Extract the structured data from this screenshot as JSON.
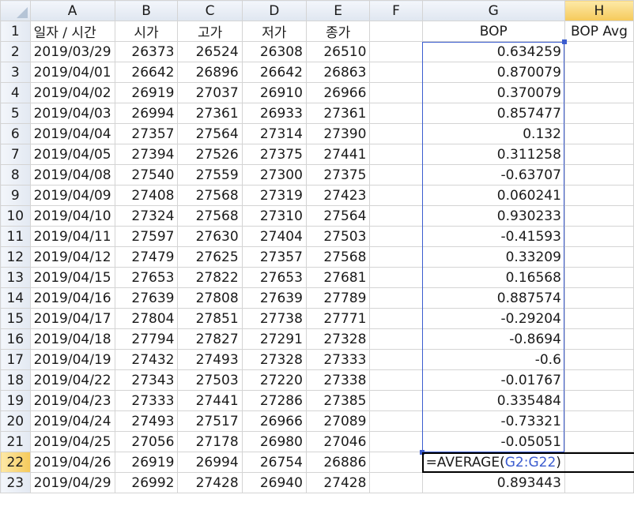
{
  "columns": [
    "A",
    "B",
    "C",
    "D",
    "E",
    "F",
    "G",
    "H"
  ],
  "header_row": {
    "number": "1",
    "cells": [
      "일자 / 시간",
      "시가",
      "고가",
      "저가",
      "종가",
      "",
      "BOP",
      "BOP Avg"
    ]
  },
  "rows": [
    {
      "n": "2",
      "date": "2019/03/29",
      "open": "26373",
      "high": "26524",
      "low": "26308",
      "close": "26510",
      "bop": "0.634259"
    },
    {
      "n": "3",
      "date": "2019/04/01",
      "open": "26642",
      "high": "26896",
      "low": "26642",
      "close": "26863",
      "bop": "0.870079"
    },
    {
      "n": "4",
      "date": "2019/04/02",
      "open": "26919",
      "high": "27037",
      "low": "26910",
      "close": "26966",
      "bop": "0.370079"
    },
    {
      "n": "5",
      "date": "2019/04/03",
      "open": "26994",
      "high": "27361",
      "low": "26933",
      "close": "27361",
      "bop": "0.857477"
    },
    {
      "n": "6",
      "date": "2019/04/04",
      "open": "27357",
      "high": "27564",
      "low": "27314",
      "close": "27390",
      "bop": "0.132"
    },
    {
      "n": "7",
      "date": "2019/04/05",
      "open": "27394",
      "high": "27526",
      "low": "27375",
      "close": "27441",
      "bop": "0.311258"
    },
    {
      "n": "8",
      "date": "2019/04/08",
      "open": "27540",
      "high": "27559",
      "low": "27300",
      "close": "27375",
      "bop": "-0.63707"
    },
    {
      "n": "9",
      "date": "2019/04/09",
      "open": "27408",
      "high": "27568",
      "low": "27319",
      "close": "27423",
      "bop": "0.060241"
    },
    {
      "n": "10",
      "date": "2019/04/10",
      "open": "27324",
      "high": "27568",
      "low": "27310",
      "close": "27564",
      "bop": "0.930233"
    },
    {
      "n": "11",
      "date": "2019/04/11",
      "open": "27597",
      "high": "27630",
      "low": "27404",
      "close": "27503",
      "bop": "-0.41593"
    },
    {
      "n": "12",
      "date": "2019/04/12",
      "open": "27479",
      "high": "27625",
      "low": "27357",
      "close": "27568",
      "bop": "0.33209"
    },
    {
      "n": "13",
      "date": "2019/04/15",
      "open": "27653",
      "high": "27822",
      "low": "27653",
      "close": "27681",
      "bop": "0.16568"
    },
    {
      "n": "14",
      "date": "2019/04/16",
      "open": "27639",
      "high": "27808",
      "low": "27639",
      "close": "27789",
      "bop": "0.887574"
    },
    {
      "n": "15",
      "date": "2019/04/17",
      "open": "27804",
      "high": "27851",
      "low": "27738",
      "close": "27771",
      "bop": "-0.29204"
    },
    {
      "n": "16",
      "date": "2019/04/18",
      "open": "27794",
      "high": "27827",
      "low": "27291",
      "close": "27328",
      "bop": "-0.8694"
    },
    {
      "n": "17",
      "date": "2019/04/19",
      "open": "27432",
      "high": "27493",
      "low": "27328",
      "close": "27333",
      "bop": "-0.6"
    },
    {
      "n": "18",
      "date": "2019/04/22",
      "open": "27343",
      "high": "27503",
      "low": "27220",
      "close": "27338",
      "bop": "-0.01767"
    },
    {
      "n": "19",
      "date": "2019/04/23",
      "open": "27333",
      "high": "27441",
      "low": "27286",
      "close": "27385",
      "bop": "0.335484"
    },
    {
      "n": "20",
      "date": "2019/04/24",
      "open": "27493",
      "high": "27517",
      "low": "26966",
      "close": "27089",
      "bop": "-0.73321"
    },
    {
      "n": "21",
      "date": "2019/04/25",
      "open": "27056",
      "high": "27178",
      "low": "26980",
      "close": "27046",
      "bop": "-0.05051"
    },
    {
      "n": "22",
      "date": "2019/04/26",
      "open": "26919",
      "high": "26994",
      "low": "26754",
      "close": "26886",
      "bop": "",
      "formula_prefix": "=AVERAGE(",
      "formula_ref": "G2:G22",
      "formula_suffix": ")"
    },
    {
      "n": "23",
      "date": "2019/04/29",
      "open": "26992",
      "high": "27428",
      "low": "26940",
      "close": "27428",
      "bop": "0.893443"
    }
  ],
  "colors": {
    "selection": "#3b5ccf",
    "header_bg": "#dfe6f0",
    "active_header": "#f5c95a"
  }
}
